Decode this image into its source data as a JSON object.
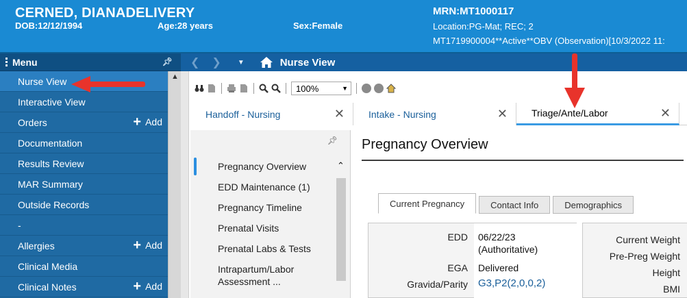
{
  "patient": {
    "name": "CERNED, DIANADELIVERY",
    "dob": "DOB:12/12/1994",
    "age": "Age:28 years",
    "sex": "Sex:Female",
    "mrn": "MRN:MT1000117",
    "location": "Location:PG-Mat; REC; 2",
    "encounter": "MT1719900004**Active**OBV (Observation)[10/3/2022 11:"
  },
  "menu": {
    "title": "Menu",
    "items": [
      {
        "label": "Nurse View",
        "add": ""
      },
      {
        "label": "Interactive View",
        "add": ""
      },
      {
        "label": "Orders",
        "add": "Add"
      },
      {
        "label": "Documentation",
        "add": ""
      },
      {
        "label": "Results Review",
        "add": ""
      },
      {
        "label": "MAR Summary",
        "add": ""
      },
      {
        "label": "Outside Records",
        "add": ""
      },
      {
        "label": "-",
        "add": ""
      },
      {
        "label": "Allergies",
        "add": "Add"
      },
      {
        "label": "Clinical Media",
        "add": ""
      },
      {
        "label": "Clinical Notes",
        "add": "Add"
      }
    ]
  },
  "nav": {
    "title": "Nurse View"
  },
  "toolbar": {
    "zoom": "100%"
  },
  "tabs": [
    {
      "label": "Handoff - Nursing"
    },
    {
      "label": "Intake - Nursing"
    },
    {
      "label": "Triage/Ante/Labor"
    }
  ],
  "sidebar_list": [
    "Pregnancy Overview",
    "EDD Maintenance (1)",
    "Pregnancy Timeline",
    "Prenatal Visits",
    "Prenatal Labs & Tests",
    "Intrapartum/Labor Assessment ..."
  ],
  "overview": {
    "title": "Pregnancy Overview",
    "sub_tabs": [
      "Current Pregnancy",
      "Contact Info",
      "Demographics"
    ],
    "fields": {
      "edd_label": "EDD",
      "edd_value": "06/22/23",
      "edd_note": "(Authoritative)",
      "ega_label": "EGA",
      "ega_value": "Delivered",
      "gp_label": "Gravida/Parity",
      "gp_value": "G3,P2(2,0,0,2)"
    },
    "right_fields": [
      "Current Weight",
      "Pre-Preg Weight",
      "Height",
      "BMI"
    ]
  },
  "colors": {
    "banner": "#1a8ad3",
    "menu": "#1f6aa3",
    "nav": "#1560a1",
    "annotation": "#e8332b"
  }
}
